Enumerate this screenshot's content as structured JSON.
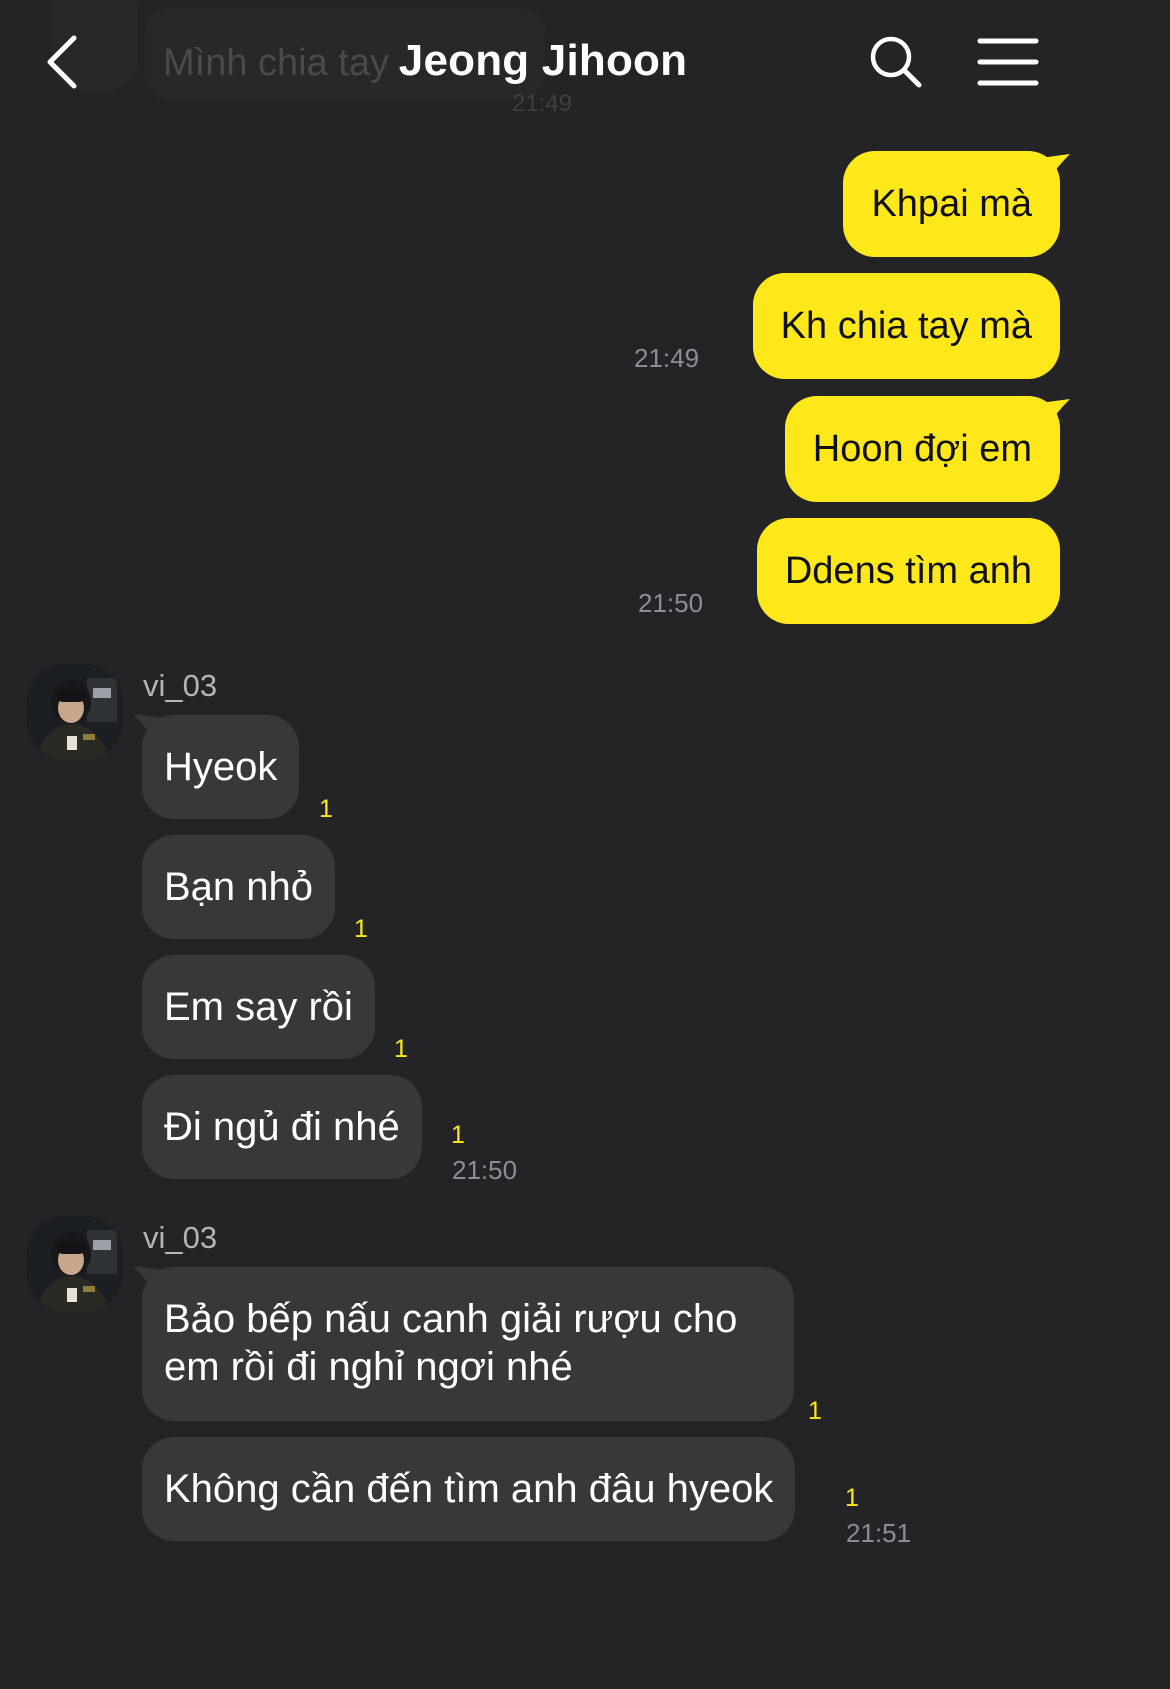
{
  "header": {
    "title": "Jeong Jihoon",
    "ghost_preview": "Mình chia tay",
    "ghost_time": "21:49"
  },
  "outgoing": [
    {
      "text": "Khpai mà",
      "time": ""
    },
    {
      "text": "Kh chia tay mà",
      "time": "21:49"
    },
    {
      "text": "Hoon đợi em",
      "time": ""
    },
    {
      "text": "Ddens tìm anh",
      "time": "21:50"
    }
  ],
  "incoming_groups": [
    {
      "sender": "vi_03",
      "messages": [
        {
          "text": "Hyeok",
          "unread": "1",
          "time": ""
        },
        {
          "text": "Bạn nhỏ",
          "unread": "1",
          "time": ""
        },
        {
          "text": "Em say rồi",
          "unread": "1",
          "time": ""
        },
        {
          "text": "Đi ngủ đi nhé",
          "unread": "1",
          "time": "21:50"
        }
      ]
    },
    {
      "sender": "vi_03",
      "messages": [
        {
          "text": "Bảo bếp nấu canh giải rượu cho em rồi đi nghỉ ngơi nhé",
          "unread": "1",
          "time": ""
        },
        {
          "text": "Không cần đến tìm anh đâu hyeok",
          "unread": "1",
          "time": "21:51"
        }
      ]
    }
  ],
  "colors": {
    "background": "#242426",
    "outgoing_bubble": "#ffe81a",
    "incoming_bubble": "#38383b",
    "unread_count": "#ffe81a"
  },
  "icons": [
    "back-chevron-icon",
    "search-icon",
    "menu-icon"
  ]
}
